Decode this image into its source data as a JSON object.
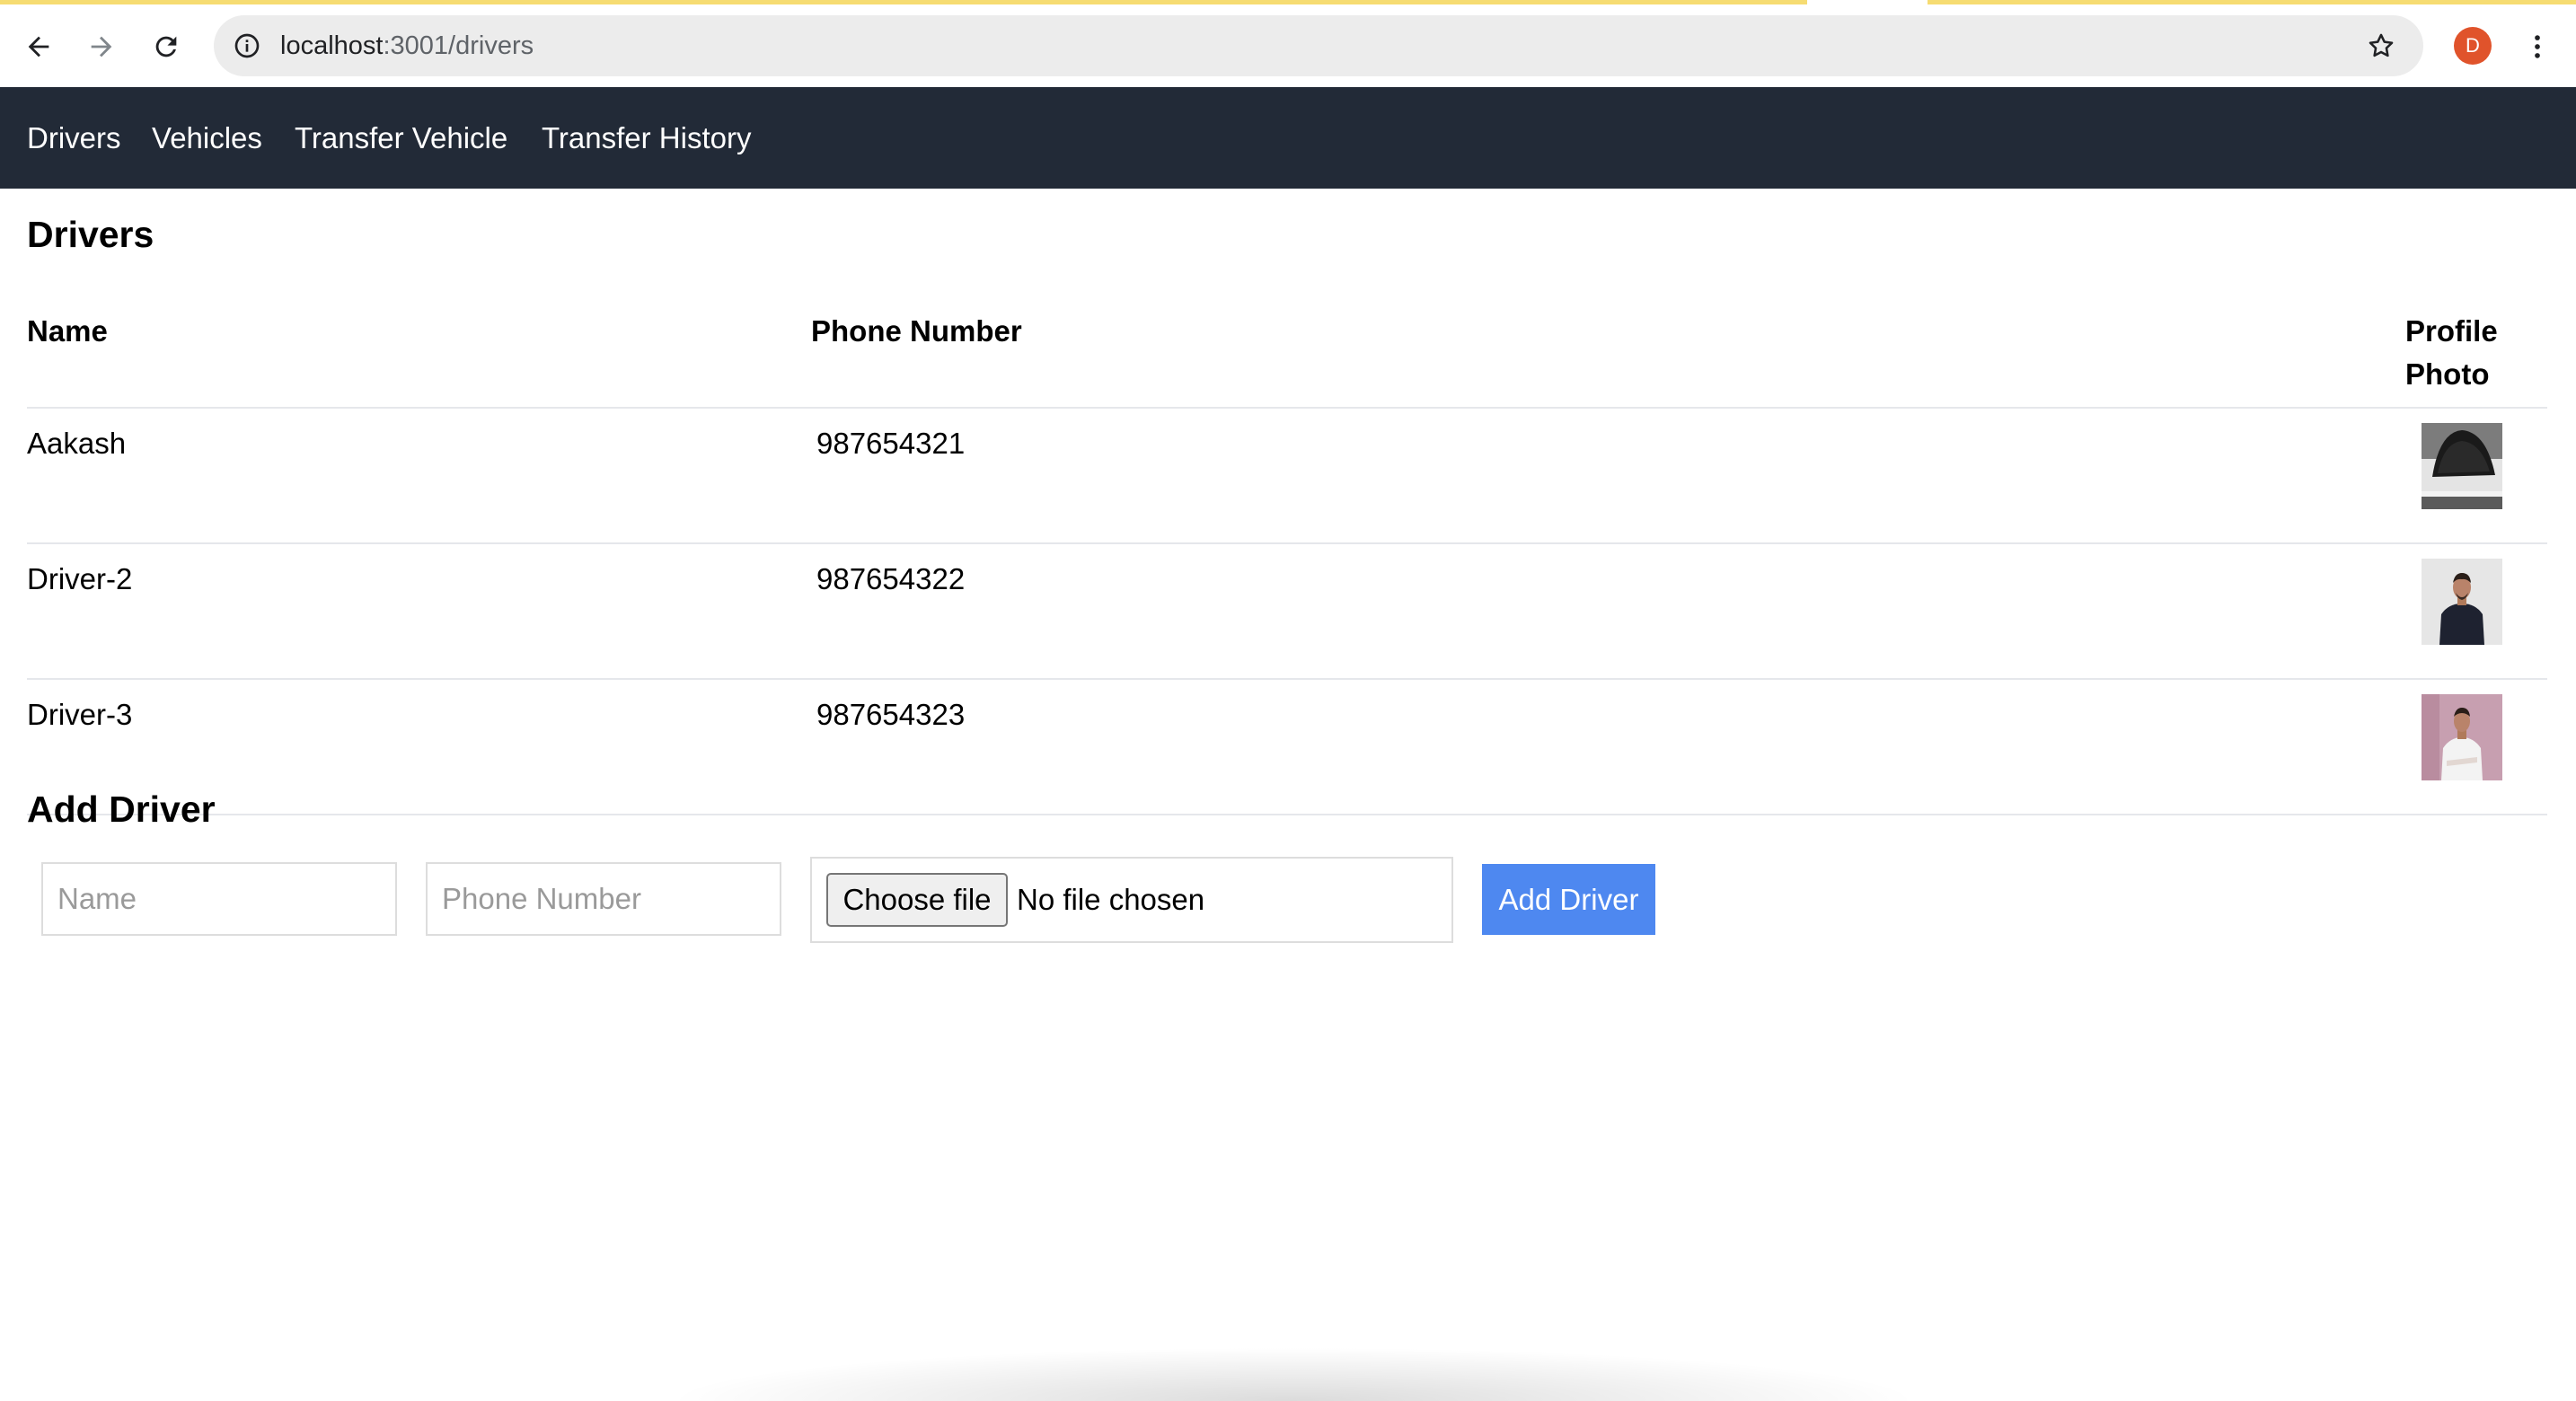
{
  "browser": {
    "url_host": "localhost",
    "url_path": ":3001/drivers",
    "profile_initial": "D",
    "icons": [
      "back-icon",
      "forward-icon",
      "reload-icon",
      "info-icon",
      "star-icon",
      "more-vert-icon"
    ],
    "colors": {
      "loading_bar": "#f6dc72",
      "avatar": "#e0532b"
    }
  },
  "nav": {
    "items": [
      {
        "label": "Drivers"
      },
      {
        "label": "Vehicles"
      },
      {
        "label": "Transfer Vehicle"
      },
      {
        "label": "Transfer History"
      }
    ],
    "background": "#222a37"
  },
  "drivers": {
    "title": "Drivers",
    "columns": {
      "name": "Name",
      "phone": "Phone Number",
      "photo_line1": "Profile",
      "photo_line2": "Photo"
    },
    "rows": [
      {
        "name": "Aakash",
        "phone": "987654321",
        "photo": "car-photo"
      },
      {
        "name": "Driver-2",
        "phone": "987654322",
        "photo": "man-dark-shirt-photo"
      },
      {
        "name": "Driver-3",
        "phone": "987654323",
        "photo": "man-white-shirt-photo"
      }
    ]
  },
  "add_driver": {
    "title": "Add Driver",
    "name_placeholder": "Name",
    "phone_placeholder": "Phone Number",
    "file_button": "Choose file",
    "file_status": "No file chosen",
    "submit_label": "Add Driver",
    "submit_color": "#4e88f0"
  }
}
